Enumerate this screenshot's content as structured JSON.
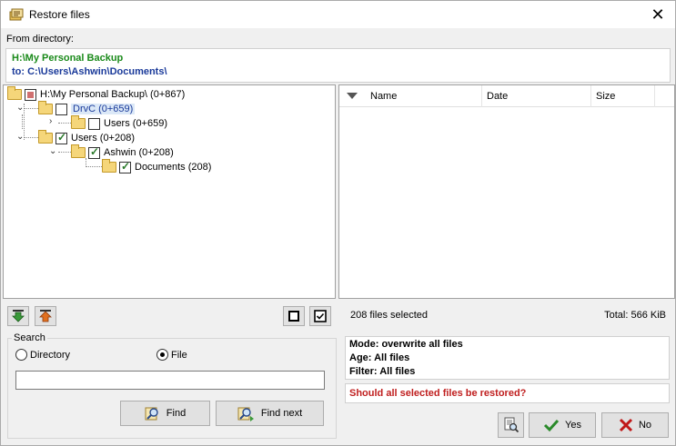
{
  "window": {
    "title": "Restore files",
    "close_glyph": "✕"
  },
  "from": {
    "label": "From directory:",
    "source": "H:\\My Personal Backup",
    "target": "to: C:\\Users\\Ashwin\\Documents\\"
  },
  "tree": {
    "items": [
      {
        "label": "H:\\My Personal Backup\\ (0+867)",
        "state": "partial"
      },
      {
        "label": "DrvC (0+659)",
        "state": "unchecked",
        "selected": true
      },
      {
        "label": "Users (0+659)",
        "state": "unchecked"
      },
      {
        "label": "Users (0+208)",
        "state": "checked"
      },
      {
        "label": "Ashwin (0+208)",
        "state": "checked"
      },
      {
        "label": "Documents (208)",
        "state": "checked"
      }
    ]
  },
  "filelist": {
    "columns": [
      "Name",
      "Date",
      "Size"
    ]
  },
  "status": {
    "selected": "208 files selected",
    "total": "Total: 566 KiB"
  },
  "search": {
    "label": "Search",
    "options": [
      "Directory",
      "File"
    ],
    "selected_option": "File",
    "input_value": "",
    "find_label": "Find",
    "find_next_label": "Find next"
  },
  "info": {
    "mode": "Mode: overwrite all files",
    "age": "Age: All files",
    "filter": "Filter: All files",
    "question": "Should all selected files be restored?"
  },
  "actions": {
    "yes_label": "Yes",
    "no_label": "No"
  },
  "colors": {
    "source": "#1a8a1a",
    "target": "#1a3a9a",
    "question": "#c02020"
  }
}
